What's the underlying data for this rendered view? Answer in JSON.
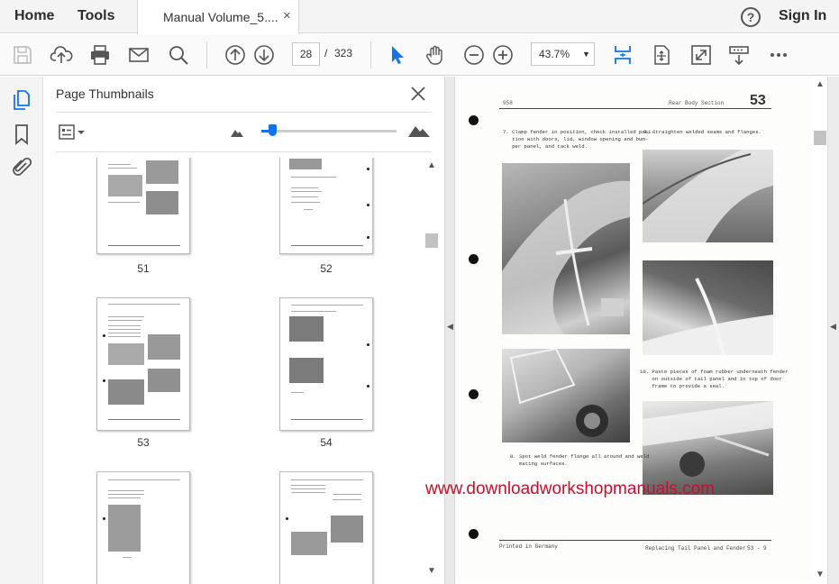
{
  "tabs": {
    "home": "Home",
    "tools": "Tools",
    "document": "Manual Volume_5....",
    "close_glyph": "×"
  },
  "header": {
    "help_glyph": "?",
    "sign_in": "Sign In"
  },
  "toolbar": {
    "current_page": "28",
    "page_separator": "/",
    "total_pages": "323",
    "zoom": "43.7%",
    "zoom_caret": "▼"
  },
  "panel": {
    "title": "Page Thumbnails",
    "slider_level_percent": 8,
    "thumbnails": [
      {
        "label": "51"
      },
      {
        "label": "52"
      },
      {
        "label": "53"
      },
      {
        "label": "54"
      },
      {
        "label": ""
      },
      {
        "label": ""
      }
    ],
    "scroll_up": "▲",
    "scroll_down": "▼"
  },
  "splitter": {
    "arrow": "◀"
  },
  "document": {
    "page_header_left": "958",
    "page_header_title": "Rear Body Section",
    "page_number": "53",
    "captions": [
      "7. Clamp fender in position, check installed posi-\n   tion with doors, lid, window opening and bum-\n   per panel, and tack weld.",
      "9. Straighten welded seams and flanges.",
      "10. Paste pieces of foam rubber underneath fender\n    on outside of tail panel and in top of door\n    frame to provide a seal.",
      "8. Spot weld fender flange all around and weld\n   mating surfaces."
    ],
    "footer_left": "Printed in Germany",
    "footer_title": "Replacing Tail Panel and Fender",
    "footer_page": "53 - 9",
    "watermark": "www.downloadworkshopmanuals.com"
  },
  "scrollbar": {
    "up": "▲",
    "down": "▼",
    "right_arrow": "◀"
  },
  "colors": {
    "accent": "#1473e6",
    "watermark": "#c8102e",
    "icon": "#555555"
  }
}
